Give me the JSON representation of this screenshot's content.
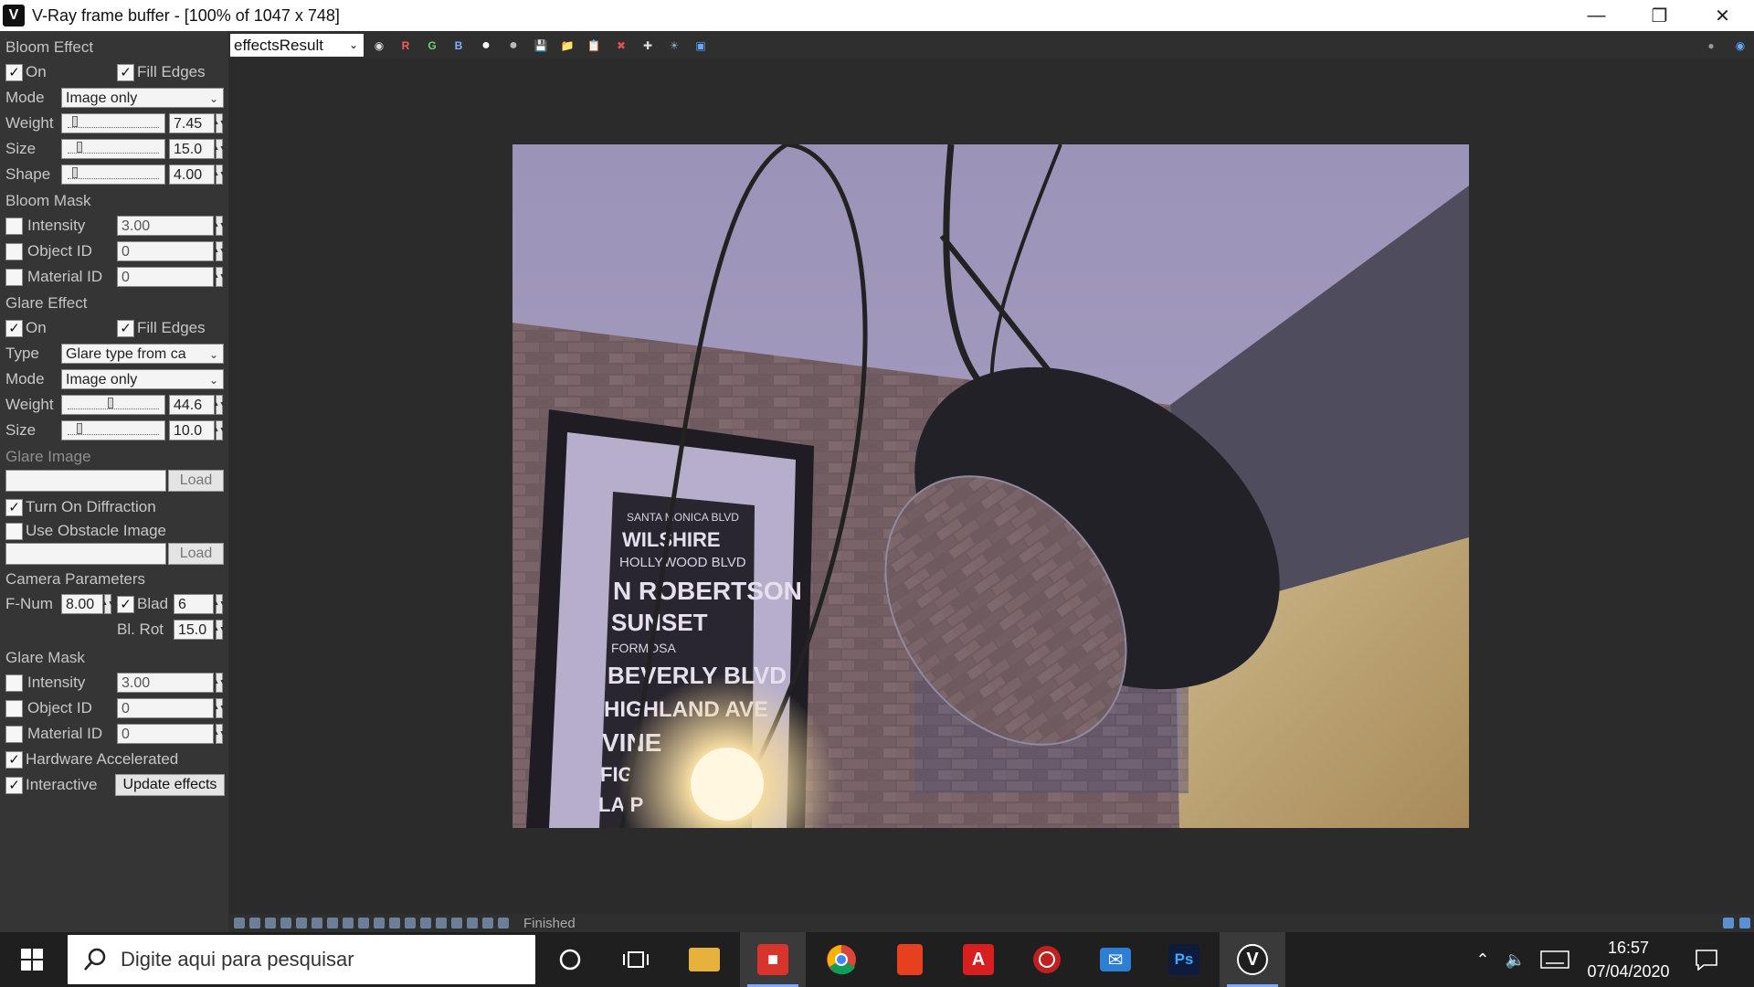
{
  "window": {
    "title": "V-Ray frame buffer - [100% of 1047 x 748]",
    "app_icon": "vray-icon",
    "controls": [
      "minimize",
      "restore",
      "close"
    ]
  },
  "toolbar": {
    "channel_value": "effectsResult",
    "letters": {
      "r": "R",
      "g": "G",
      "b": "B"
    }
  },
  "panel": {
    "bloom_effect": {
      "heading": "Bloom Effect",
      "on_label": "On",
      "on_checked": true,
      "fill_edges_label": "Fill Edges",
      "fill_edges_checked": true,
      "mode_label": "Mode",
      "mode_value": "Image only",
      "weight_label": "Weight",
      "weight_value": "7.45",
      "weight_level": 0.05,
      "size_label": "Size",
      "size_value": "15.0",
      "size_level": 0.1,
      "shape_label": "Shape",
      "shape_value": "4.00",
      "shape_level": 0.05
    },
    "bloom_mask": {
      "heading": "Bloom Mask",
      "intensity_label": "Intensity",
      "intensity_value": "3.00",
      "object_id_label": "Object ID",
      "object_id_value": "0",
      "material_id_label": "Material ID",
      "material_id_value": "0"
    },
    "glare_effect": {
      "heading": "Glare Effect",
      "on_label": "On",
      "fill_edges_label": "Fill Edges",
      "type_label": "Type",
      "type_value": "Glare type from ca",
      "mode_label": "Mode",
      "mode_value": "Image only",
      "weight_label": "Weight",
      "weight_value": "44.6",
      "weight_level": 0.45,
      "size_label": "Size",
      "size_value": "10.0",
      "size_level": 0.1
    },
    "glare_image": {
      "heading": "Glare Image",
      "load_label": "Load",
      "diffraction_label": "Turn On Diffraction",
      "obstacle_label": "Use Obstacle Image",
      "load2_label": "Load"
    },
    "camera": {
      "heading": "Camera Parameters",
      "fnum_label": "F-Num",
      "fnum_value": "8.00",
      "blades_label": "Blad",
      "blades_value": "6",
      "blrot_label": "Bl. Rot",
      "blrot_value": "15.0"
    },
    "glare_mask": {
      "heading": "Glare Mask",
      "intensity_label": "Intensity",
      "intensity_value": "3.00",
      "object_id_label": "Object ID",
      "object_id_value": "0",
      "material_id_label": "Material ID",
      "material_id_value": "0"
    },
    "hardware_label": "Hardware Accelerated",
    "interactive_label": "Interactive",
    "update_label": "Update effects"
  },
  "render": {
    "poster_lines": [
      "SANTA MONICA BLVD",
      "WILSHIRE",
      "HOLLYWOOD BLVD",
      "N ROBERTSON",
      "SUNSET",
      "FORMOSA",
      "BEVERLY BLVD",
      "HIGHLAND AVE",
      "VINE",
      "FIG",
      "LA P"
    ]
  },
  "status": {
    "text": "Finished"
  },
  "taskbar": {
    "search_placeholder": "Digite aqui para pesquisar",
    "apps": [
      "cortana-icon",
      "task-view-icon",
      "file-explorer-icon",
      "sketchup-icon",
      "chrome-icon",
      "office-icon",
      "autocad-icon",
      "app-red-icon",
      "mail-icon",
      "photoshop-icon",
      "vray-icon"
    ],
    "time": "16:57",
    "date": "07/04/2020"
  }
}
